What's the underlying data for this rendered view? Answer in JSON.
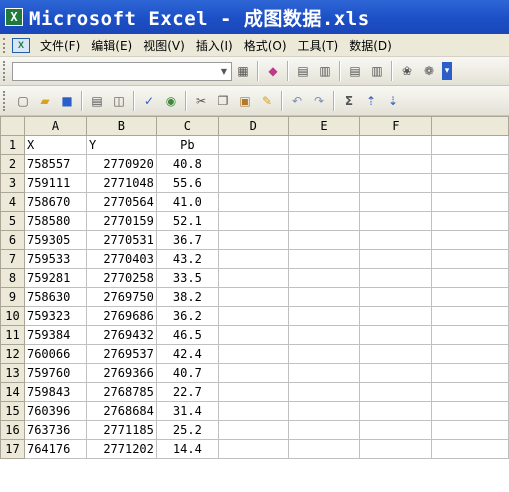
{
  "title": "Microsoft Excel - 成图数据.xls",
  "menu": [
    "文件(F)",
    "编辑(E)",
    "视图(V)",
    "插入(I)",
    "格式(O)",
    "工具(T)",
    "数据(D)"
  ],
  "columns": [
    "A",
    "B",
    "C",
    "D",
    "E",
    "F",
    ""
  ],
  "rows": [
    {
      "n": "1",
      "a": "X",
      "b": "Y",
      "c": "Pb"
    },
    {
      "n": "2",
      "a": "758557",
      "b": "2770920",
      "c": "40.8"
    },
    {
      "n": "3",
      "a": "759111",
      "b": "2771048",
      "c": "55.6"
    },
    {
      "n": "4",
      "a": "758670",
      "b": "2770564",
      "c": "41.0"
    },
    {
      "n": "5",
      "a": "758580",
      "b": "2770159",
      "c": "52.1"
    },
    {
      "n": "6",
      "a": "759305",
      "b": "2770531",
      "c": "36.7"
    },
    {
      "n": "7",
      "a": "759533",
      "b": "2770403",
      "c": "43.2"
    },
    {
      "n": "8",
      "a": "759281",
      "b": "2770258",
      "c": "33.5"
    },
    {
      "n": "9",
      "a": "758630",
      "b": "2769750",
      "c": "38.2"
    },
    {
      "n": "10",
      "a": "759323",
      "b": "2769686",
      "c": "36.2"
    },
    {
      "n": "11",
      "a": "759384",
      "b": "2769432",
      "c": "46.5"
    },
    {
      "n": "12",
      "a": "760066",
      "b": "2769537",
      "c": "42.4"
    },
    {
      "n": "13",
      "a": "759760",
      "b": "2769366",
      "c": "40.7"
    },
    {
      "n": "14",
      "a": "759843",
      "b": "2768785",
      "c": "22.7"
    },
    {
      "n": "15",
      "a": "760396",
      "b": "2768684",
      "c": "31.4"
    },
    {
      "n": "16",
      "a": "763736",
      "b": "2771185",
      "c": "25.2"
    },
    {
      "n": "17",
      "a": "764176",
      "b": "2771202",
      "c": "14.4"
    }
  ],
  "icons": {
    "app": "excel-app-icon",
    "toolbar1": [
      "chart-wizard-icon",
      "drawing-icon",
      "border-icon",
      "merge-icon",
      "spell-icon",
      "research-icon"
    ],
    "toolbar2": [
      "new-icon",
      "open-icon",
      "save-icon",
      "print-icon",
      "print-preview-icon",
      "spelling-icon",
      "research-icon",
      "cut-icon",
      "copy-icon",
      "paste-icon",
      "format-painter-icon",
      "undo-icon",
      "redo-icon",
      "autosum-icon",
      "sort-ascending-icon",
      "sort-descending-icon"
    ]
  },
  "colors": {
    "titlebar": "#2559cf",
    "chrome": "#ece9d8",
    "gridline": "#c0c0c0"
  }
}
